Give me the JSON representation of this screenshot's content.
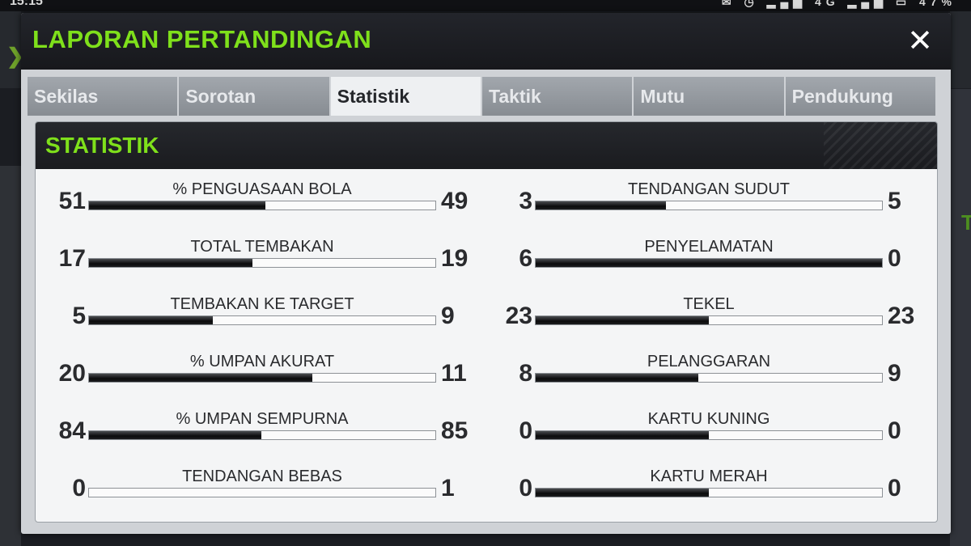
{
  "status_bar": {
    "time": "15:15",
    "icons": "✉ ◷ ▂▄▆ 4G ▂▄▆ ▭ 47%"
  },
  "background": {
    "left_tab_glyph": "❯",
    "right_letter": "T"
  },
  "dialog": {
    "title": "LAPORAN PERTANDINGAN",
    "close_glyph": "✕",
    "tabs": [
      {
        "label": "Sekilas",
        "active": false
      },
      {
        "label": "Sorotan",
        "active": false
      },
      {
        "label": "Statistik",
        "active": true
      },
      {
        "label": "Taktik",
        "active": false
      },
      {
        "label": "Mutu",
        "active": false
      },
      {
        "label": "Pendukung",
        "active": false
      }
    ]
  },
  "panel": {
    "title": "STATISTIK"
  },
  "colors": {
    "title_green": "#7fe01b",
    "bar_fill": "#111112"
  },
  "stats": {
    "left_column": [
      {
        "label": "% PENGUASAAN BOLA",
        "home": "51",
        "away": "49",
        "home_share": 0.51
      },
      {
        "label": "TOTAL TEMBAKAN",
        "home": "17",
        "away": "19",
        "home_share": 0.4722
      },
      {
        "label": "TEMBAKAN KE TARGET",
        "home": "5",
        "away": "9",
        "home_share": 0.3571
      },
      {
        "label": "% UMPAN AKURAT",
        "home": "20",
        "away": "11",
        "home_share": 0.6452
      },
      {
        "label": "% UMPAN SEMPURNA",
        "home": "84",
        "away": "85",
        "home_share": 0.497
      },
      {
        "label": "TENDANGAN BEBAS",
        "home": "0",
        "away": "1",
        "home_share": 0
      }
    ],
    "right_column": [
      {
        "label": "TENDANGAN SUDUT",
        "home": "3",
        "away": "5",
        "home_share": 0.375
      },
      {
        "label": "PENYELAMATAN",
        "home": "6",
        "away": "0",
        "home_share": 1
      },
      {
        "label": "TEKEL",
        "home": "23",
        "away": "23",
        "home_share": 0.5
      },
      {
        "label": "PELANGGARAN",
        "home": "8",
        "away": "9",
        "home_share": 0.4706
      },
      {
        "label": "KARTU KUNING",
        "home": "0",
        "away": "0",
        "home_share": 0.5
      },
      {
        "label": "KARTU MERAH",
        "home": "0",
        "away": "0",
        "home_share": 0.5
      }
    ]
  }
}
